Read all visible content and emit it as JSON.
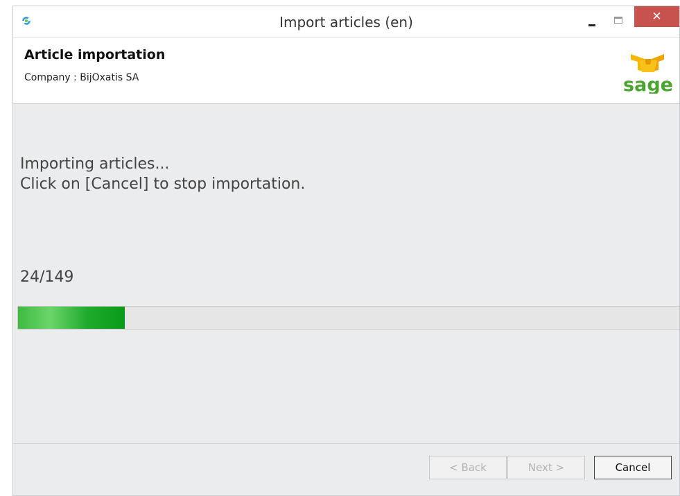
{
  "window": {
    "title": "Import articles (en)",
    "close_glyph": "✕"
  },
  "header": {
    "title": "Article importation",
    "company": "Company : BijOxatis SA",
    "logo_text": "sage",
    "logo_color": "#4aa52e",
    "logo_box_color": "#f5b800"
  },
  "status": {
    "line1": "Importing articles...",
    "line2": "Click on [Cancel] to stop importation.",
    "counter": "24/149",
    "current": 24,
    "total": 149
  },
  "buttons": {
    "back": "< Back",
    "next": "Next >",
    "cancel": "Cancel"
  },
  "icons": {
    "app": "refresh-icon",
    "minimize": "minimize-icon",
    "maximize": "maximize-icon",
    "close": "close-icon",
    "logo": "sage-logo"
  }
}
